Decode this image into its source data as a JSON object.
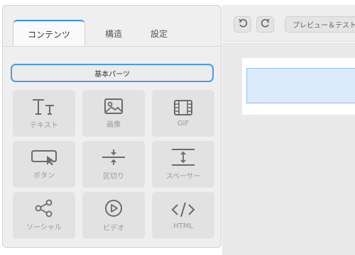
{
  "tabs": [
    {
      "label": "コンテンツ",
      "active": true
    },
    {
      "label": "構造",
      "active": false
    },
    {
      "label": "設定",
      "active": false
    }
  ],
  "parts_header": "基本パーツ",
  "tiles": [
    {
      "label": "テキスト",
      "icon": "text-format-icon"
    },
    {
      "label": "画像",
      "icon": "image-icon"
    },
    {
      "label": "GIF",
      "icon": "film-icon"
    },
    {
      "label": "ボタン",
      "icon": "button-cursor-icon"
    },
    {
      "label": "区切り",
      "icon": "divider-icon"
    },
    {
      "label": "スペーサー",
      "icon": "spacer-icon"
    },
    {
      "label": "ソーシャル",
      "icon": "share-icon"
    },
    {
      "label": "ビデオ",
      "icon": "play-circle-icon"
    },
    {
      "label": "HTML",
      "icon": "code-icon"
    }
  ],
  "toolbar": {
    "undo_icon": "undo-icon",
    "redo_icon": "redo-icon",
    "preview_label": "プレビュー＆テスト"
  },
  "colors": {
    "accent": "#3a8ee6",
    "selection_fill": "#dcebfb",
    "panel_bg": "#efefef",
    "tile_bg": "#e2e2e2"
  }
}
